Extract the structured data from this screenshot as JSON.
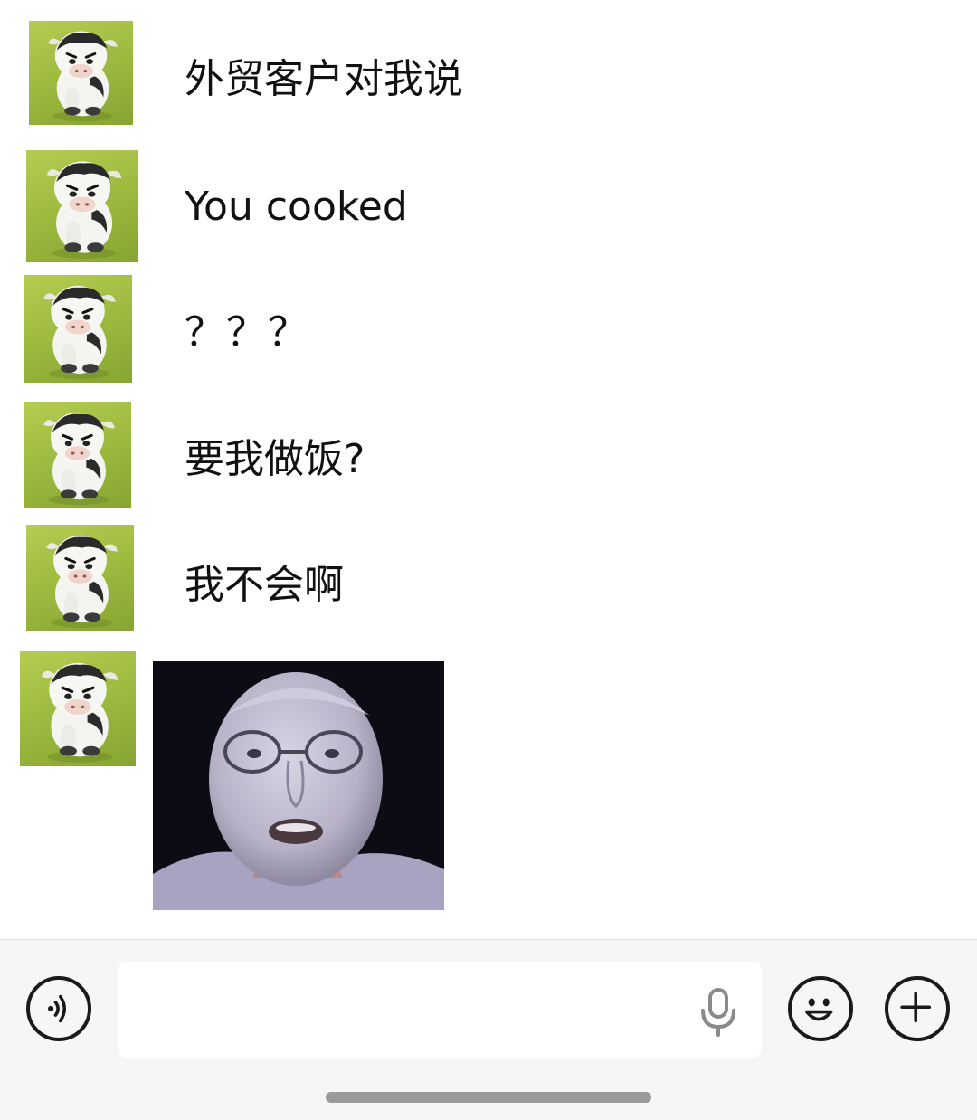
{
  "conversation": {
    "messages": [
      {
        "type": "text",
        "text": "外贸客户对我说"
      },
      {
        "type": "text",
        "text": "You cooked"
      },
      {
        "type": "text",
        "text": "？？？"
      },
      {
        "type": "text",
        "text": "要我做饭?"
      },
      {
        "type": "text",
        "text": "我不会啊"
      },
      {
        "type": "sticker",
        "icon": "shocked-face-sticker"
      }
    ],
    "avatar_icon": "cow-avatar-icon"
  },
  "input_bar": {
    "message_input": {
      "value": "",
      "placeholder": ""
    },
    "icons": {
      "voice_toggle": "voice-icon",
      "microphone": "microphone-icon",
      "emoji": "emoji-icon",
      "more": "plus-icon"
    }
  },
  "colors": {
    "avatar_background": "#9ab83d",
    "input_bar_background": "#f6f6f6",
    "text": "#111111"
  }
}
